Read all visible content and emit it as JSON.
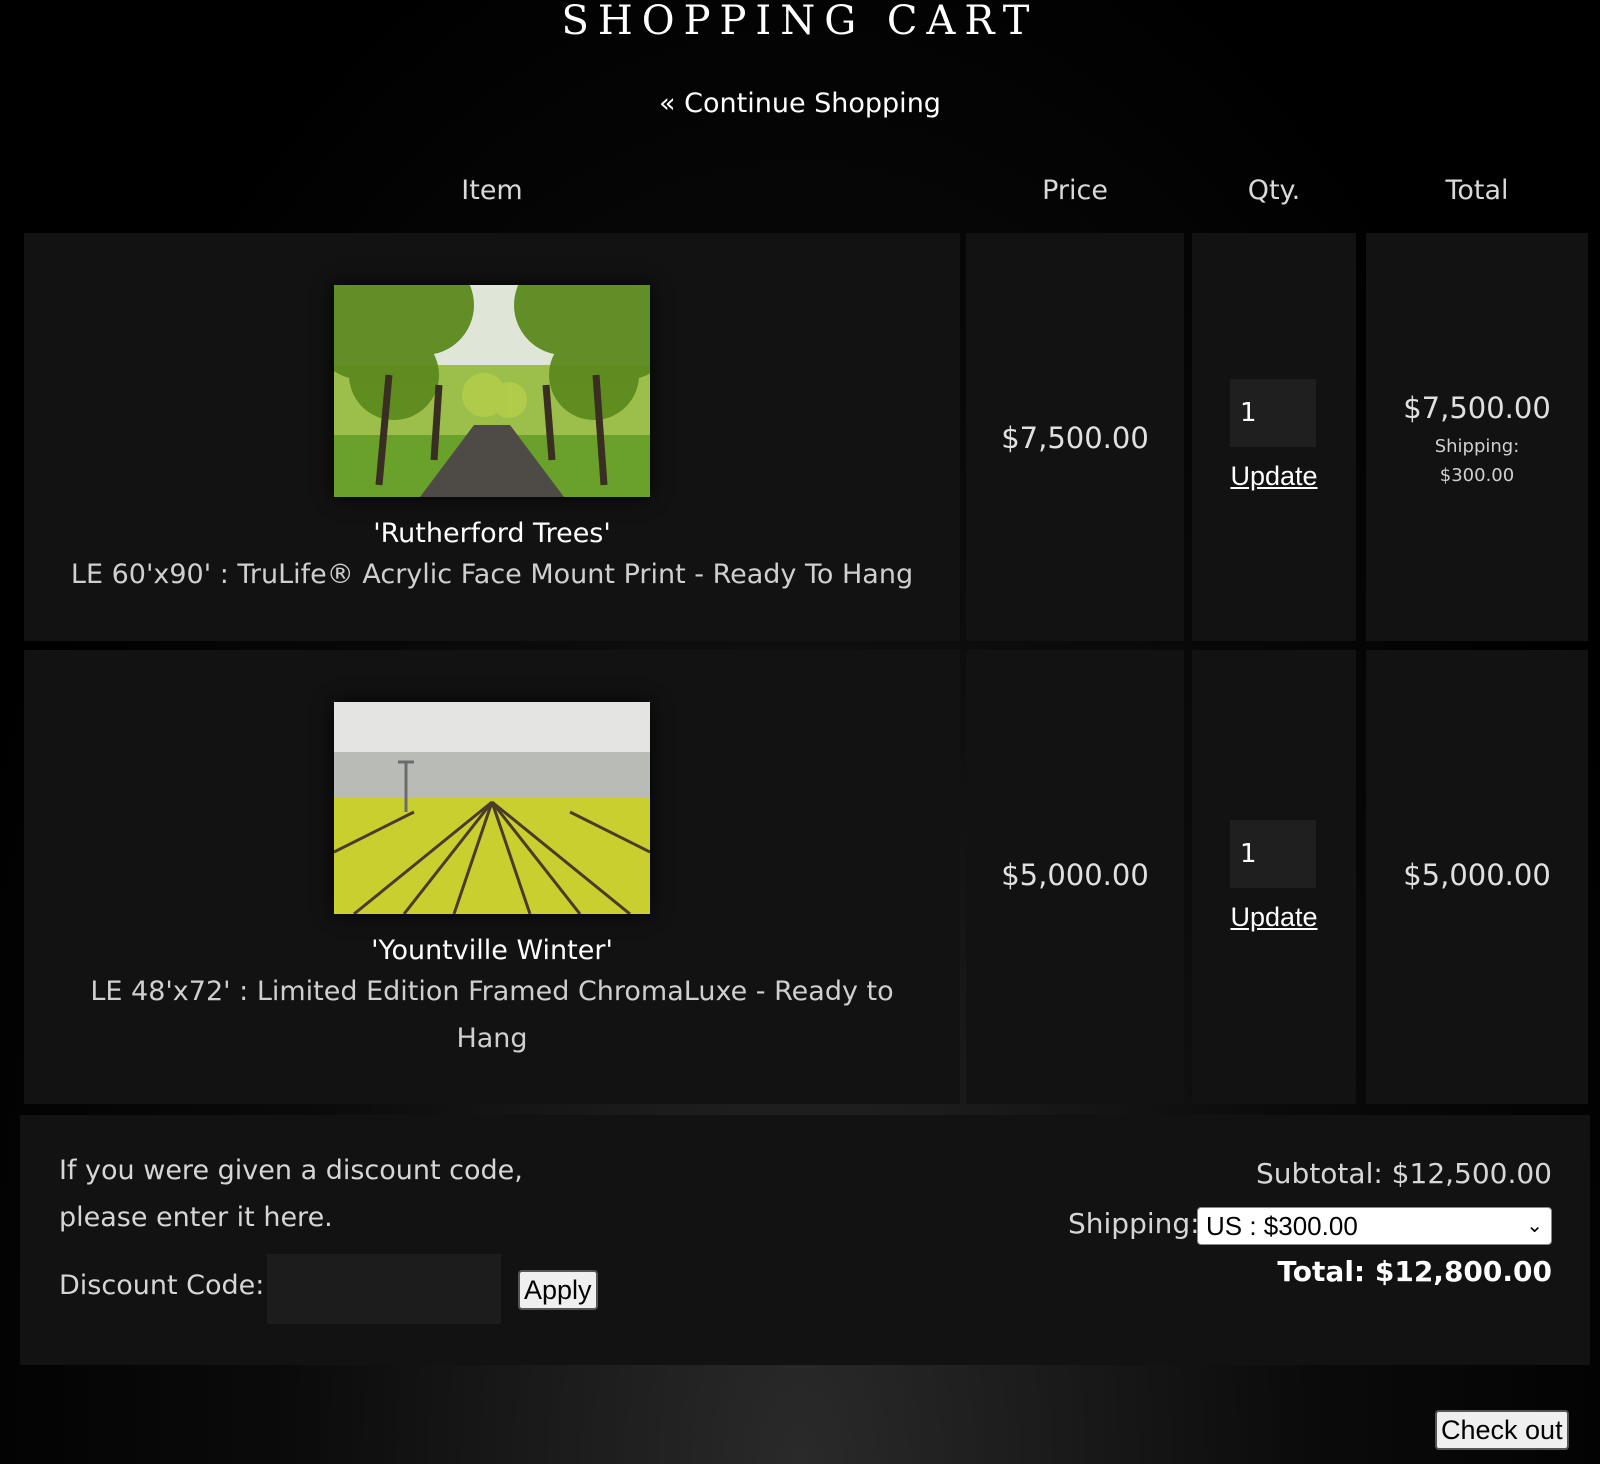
{
  "page": {
    "title": "SHOPPING CART",
    "continue_link": "« Continue Shopping"
  },
  "table": {
    "headers": {
      "item": "Item",
      "price": "Price",
      "qty": "Qty.",
      "total": "Total"
    },
    "rows": [
      {
        "title": "'Rutherford Trees'",
        "description": "LE 60'x90' : TruLife® Acrylic Face Mount Print - Ready To Hang",
        "price": "$7,500.00",
        "qty": "1",
        "update_label": "Update",
        "total": "$7,500.00",
        "shipping_label": "Shipping:",
        "shipping_amount": "$300.00"
      },
      {
        "title": "'Yountville Winter'",
        "description": "LE 48'x72' : Limited Edition Framed ChromaLuxe - Ready to Hang",
        "price": "$5,000.00",
        "qty": "1",
        "update_label": "Update",
        "total": "$5,000.00"
      }
    ]
  },
  "summary": {
    "discount_prompt_line1": "If you were given a discount code,",
    "discount_prompt_line2": "please enter it here.",
    "discount_label": "Discount Code:",
    "discount_value": "",
    "apply_label": "Apply",
    "subtotal": "Subtotal: $12,500.00",
    "shipping_label": "Shipping:",
    "shipping_selected": "US : $300.00",
    "total": "Total: $12,800.00"
  },
  "checkout_label": "Check out"
}
